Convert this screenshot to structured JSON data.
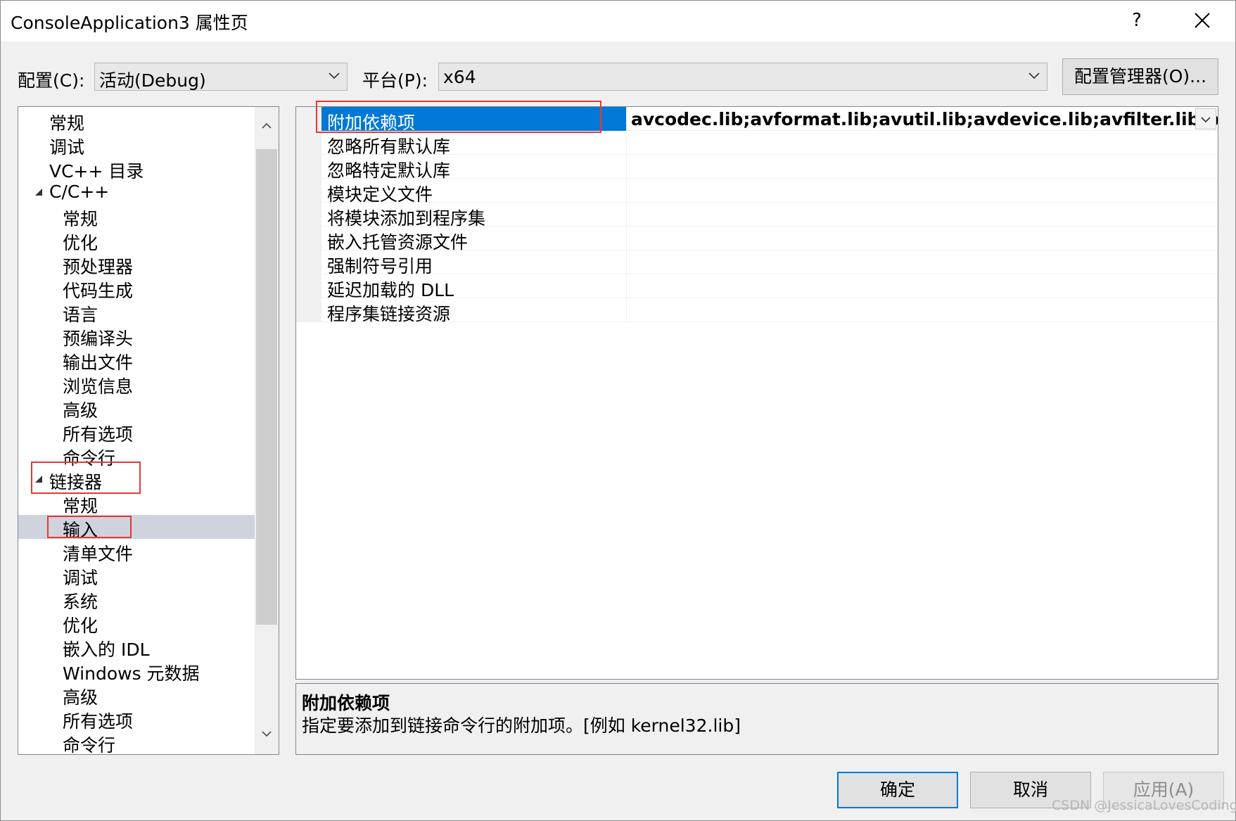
{
  "window": {
    "title": "ConsoleApplication3 属性页",
    "help": "?"
  },
  "config_bar": {
    "config_label": "配置(C):",
    "config_value": "活动(Debug)",
    "platform_label": "平台(P):",
    "platform_value": "x64",
    "manager_button": "配置管理器(O)..."
  },
  "tree": {
    "items": [
      {
        "label": "常规",
        "level": 1
      },
      {
        "label": "调试",
        "level": 1
      },
      {
        "label": "VC++ 目录",
        "level": 1
      },
      {
        "label": "C/C++",
        "level": 1,
        "expanded": true
      },
      {
        "label": "常规",
        "level": 2
      },
      {
        "label": "优化",
        "level": 2
      },
      {
        "label": "预处理器",
        "level": 2
      },
      {
        "label": "代码生成",
        "level": 2
      },
      {
        "label": "语言",
        "level": 2
      },
      {
        "label": "预编译头",
        "level": 2
      },
      {
        "label": "输出文件",
        "level": 2
      },
      {
        "label": "浏览信息",
        "level": 2
      },
      {
        "label": "高级",
        "level": 2
      },
      {
        "label": "所有选项",
        "level": 2
      },
      {
        "label": "命令行",
        "level": 2
      },
      {
        "label": "链接器",
        "level": 1,
        "expanded": true
      },
      {
        "label": "常规",
        "level": 2
      },
      {
        "label": "输入",
        "level": 2,
        "selected": true
      },
      {
        "label": "清单文件",
        "level": 2
      },
      {
        "label": "调试",
        "level": 2
      },
      {
        "label": "系统",
        "level": 2
      },
      {
        "label": "优化",
        "level": 2
      },
      {
        "label": "嵌入的 IDL",
        "level": 2
      },
      {
        "label": "Windows 元数据",
        "level": 2
      },
      {
        "label": "高级",
        "level": 2
      },
      {
        "label": "所有选项",
        "level": 2
      },
      {
        "label": "命令行",
        "level": 2
      }
    ]
  },
  "properties": {
    "rows": [
      {
        "name": "附加依赖项",
        "value": "avcodec.lib;avformat.lib;avutil.lib;avdevice.lib;avfilter.lib;postproc.",
        "selected": true
      },
      {
        "name": "忽略所有默认库",
        "value": ""
      },
      {
        "name": "忽略特定默认库",
        "value": ""
      },
      {
        "name": "模块定义文件",
        "value": ""
      },
      {
        "name": "将模块添加到程序集",
        "value": ""
      },
      {
        "name": "嵌入托管资源文件",
        "value": ""
      },
      {
        "name": "强制符号引用",
        "value": ""
      },
      {
        "name": "延迟加载的 DLL",
        "value": ""
      },
      {
        "name": "程序集链接资源",
        "value": ""
      }
    ]
  },
  "description": {
    "title": "附加依赖项",
    "text": "指定要添加到链接命令行的附加项。[例如 kernel32.lib]"
  },
  "buttons": {
    "ok": "确定",
    "cancel": "取消",
    "apply": "应用(A)"
  },
  "watermark": "CSDN @JessicaLovesCoding",
  "colors": {
    "selection": "#0078d7",
    "tree_selection": "#cfd3de",
    "highlight_box": "#e53935"
  }
}
